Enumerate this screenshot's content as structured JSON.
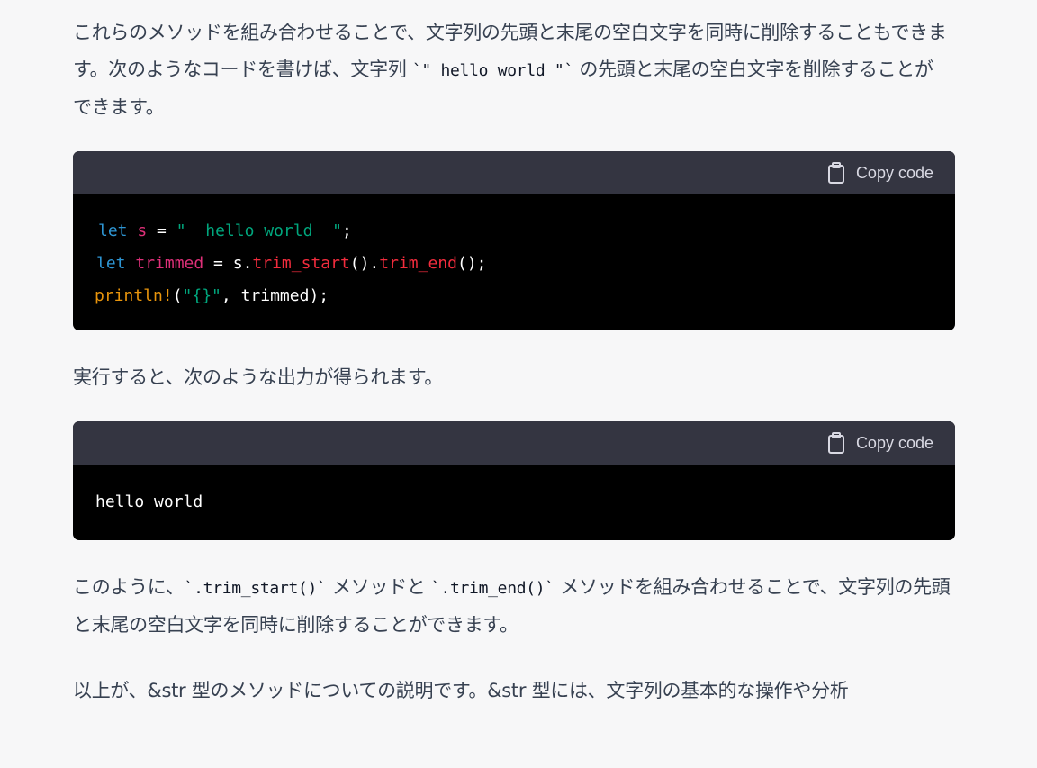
{
  "paragraphs": {
    "p1_line1": "これらのメソッドを組み合わせることで、文字列の先頭と末尾の空白文字を同時に削除することもできま",
    "p1_line2_a": "す。次のようなコードを書けば、文字列 ",
    "p1_line2_code": "`\" hello world \"`",
    "p1_line2_b": " の先頭と末尾の空白文字を削除することが",
    "p1_line3": "できます。",
    "p2": "実行すると、次のような出力が得られます。",
    "p3_line1_a": "このように、",
    "p3_code1": "`.trim_start()`",
    "p3_line1_b": " メソッドと ",
    "p3_code2": "`.trim_end()`",
    "p3_line1_c": " メソッドを組み合わせることで、文字列の先頭",
    "p3_line2": "と末尾の空白文字を同時に削除することができます。",
    "p4": "以上が、&str 型のメソッドについての説明です。&str 型には、文字列の基本的な操作や分析"
  },
  "code_blocks": [
    {
      "copy_label": "Copy code",
      "lines": [
        {
          "t1": "let",
          "t2": " ",
          "t3": "s",
          "t4": " = ",
          "t5": "\"  hello world  \"",
          "t6": ";"
        },
        {
          "t1": "let",
          "t2": " ",
          "t3": "trimmed",
          "t4": " = s.",
          "t5": "trim_start",
          "t6": "().",
          "t7": "trim_end",
          "t8": "();"
        },
        {
          "t1": "println!",
          "t2": "(",
          "t3": "\"{}\"",
          "t4": ", trimmed);"
        }
      ]
    },
    {
      "copy_label": "Copy code",
      "lines": [
        {
          "t1": "hello world"
        }
      ]
    }
  ],
  "colors": {
    "keyword": "#2e95d3",
    "variable": "#df3079",
    "string": "#00a67d",
    "function": "#f22c3d",
    "macro": "#e9950c",
    "header_bg": "#343541",
    "code_bg": "#000000",
    "page_bg": "#f7f7f8"
  },
  "icons": {
    "copy": "clipboard-icon"
  }
}
